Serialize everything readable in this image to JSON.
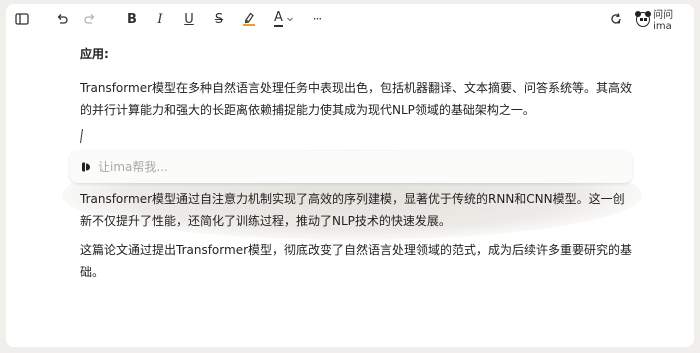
{
  "toolbar": {
    "items": [
      {
        "name": "sidebar-toggle",
        "icon": "sidebar-icon"
      },
      {
        "name": "undo",
        "icon": "undo-icon"
      },
      {
        "name": "redo",
        "icon": "redo-icon"
      },
      {
        "name": "bold",
        "label": "B"
      },
      {
        "name": "italic",
        "label": "I"
      },
      {
        "name": "underline",
        "label": "U"
      },
      {
        "name": "strikethrough",
        "label": "S"
      },
      {
        "name": "highlight",
        "icon": "highlighter-icon"
      },
      {
        "name": "text-color",
        "label": "A"
      },
      {
        "name": "more",
        "label": "···"
      }
    ],
    "ask_ima_label": "问问ima",
    "highlight_color": "#f0a020"
  },
  "document": {
    "heading": "应用:",
    "paragraph1": "Transformer模型在多种自然语言处理任务中表现出色，包括机器翻译、文本摘要、问答系统等。其高效的并行计算能力和强大的长距离依赖捕捉能力使其成为现代NLP领域的基础架构之一。",
    "ai_prompt_placeholder": "让ima帮我...",
    "paragraph2": "Transformer模型通过自注意力机制实现了高效的序列建模，显著优于传统的RNN和CNN模型。这一创新不仅提升了性能，还简化了训练过程，推动了NLP技术的快速发展。",
    "paragraph3": "这篇论文通过提出Transformer模型，彻底改变了自然语言处理领域的范式，成为后续许多重要研究的基础。"
  }
}
